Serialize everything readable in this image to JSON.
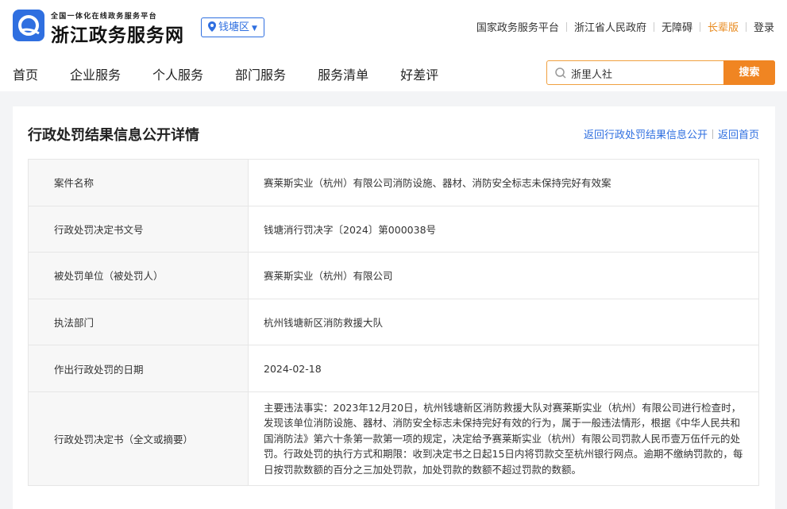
{
  "header": {
    "brand_top": "全国一体化在线政务服务平台",
    "brand_main": "浙江政务服务网",
    "region": "钱塘区",
    "top_links": [
      "国家政务服务平台",
      "浙江省人民政府",
      "无障碍",
      "长辈版",
      "登录"
    ],
    "nav": [
      "首页",
      "企业服务",
      "个人服务",
      "部门服务",
      "服务清单",
      "好差评"
    ],
    "search": {
      "value": "浙里人社",
      "button": "搜索"
    }
  },
  "colors": {
    "primary": "#2f6fe0",
    "accent": "#f08522",
    "elder_link": "#e88a1e"
  },
  "card": {
    "title": "行政处罚结果信息公开详情",
    "links": [
      "返回行政处罚结果信息公开",
      "返回首页"
    ],
    "rows": [
      {
        "label": "案件名称",
        "value": "赛莱斯实业（杭州）有限公司消防设施、器材、消防安全标志未保持完好有效案"
      },
      {
        "label": "行政处罚决定书文号",
        "value": "钱塘消行罚决字〔2024〕第000038号"
      },
      {
        "label": "被处罚单位（被处罚人）",
        "value": "赛莱斯实业（杭州）有限公司"
      },
      {
        "label": "执法部门",
        "value": "杭州钱塘新区消防救援大队"
      },
      {
        "label": "作出行政处罚的日期",
        "value": "2024-02-18"
      },
      {
        "label": "行政处罚决定书（全文或摘要）",
        "value": "主要违法事实：2023年12月20日，杭州钱塘新区消防救援大队对赛莱斯实业（杭州）有限公司进行检查时，发现该单位消防设施、器材、消防安全标志未保持完好有效的行为，属于一般违法情形，根据《中华人民共和国消防法》第六十条第一款第一项的规定，决定给予赛莱斯实业（杭州）有限公司罚款人民币壹万伍仟元的处罚。行政处罚的执行方式和期限：收到决定书之日起15日内将罚款交至杭州银行网点。逾期不缴纳罚款的，每日按罚款数额的百分之三加处罚款，加处罚款的数额不超过罚款的数额。"
      }
    ]
  }
}
